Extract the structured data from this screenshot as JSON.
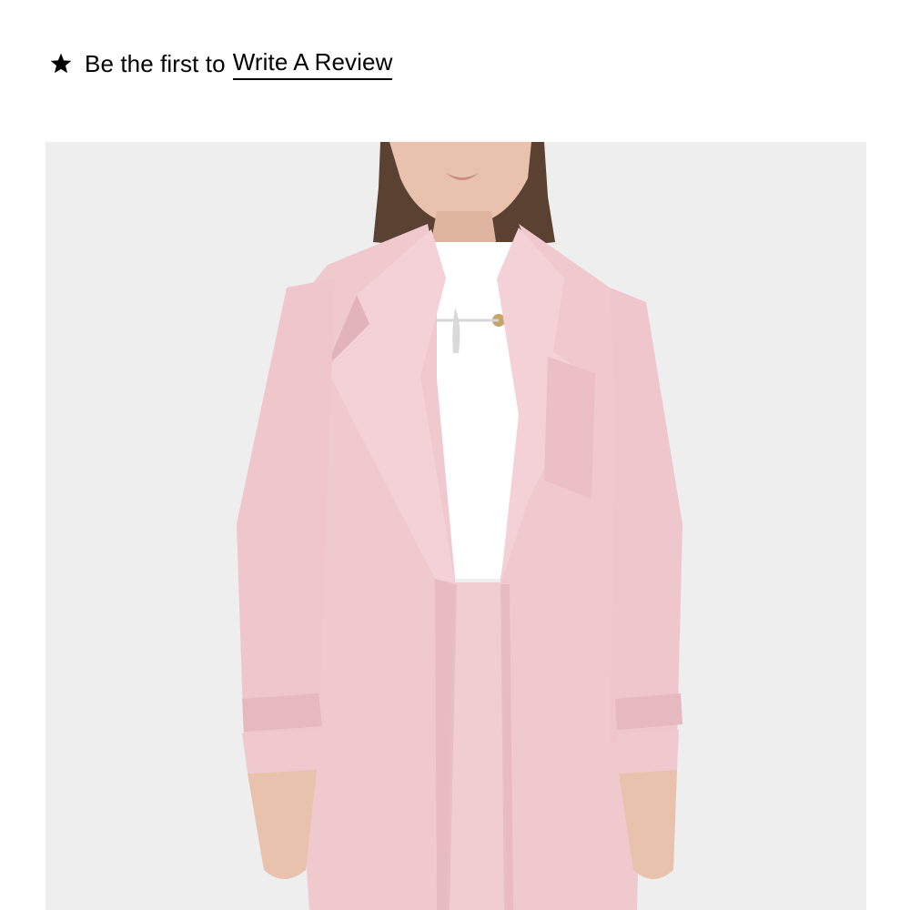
{
  "review": {
    "icon": "star-icon",
    "prompt": "Be the first to",
    "link_label": "Write A Review"
  },
  "product": {
    "image_icon": "product-photo",
    "colors": {
      "background": "#eeeeee",
      "coat": "#f0c9cf",
      "coat_shadow": "#e2b3bb",
      "blouse": "#ffffff",
      "skin": "#e8c2ac",
      "hair": "#5a4132"
    }
  }
}
